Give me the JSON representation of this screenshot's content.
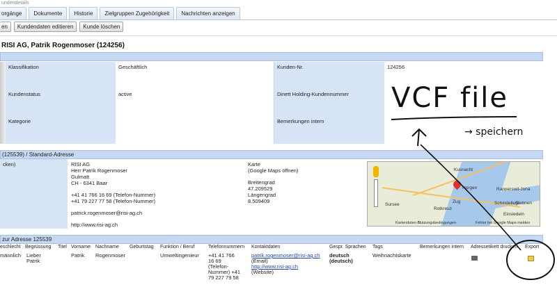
{
  "breadcrumb": "undendetails",
  "tabs": [
    "orgänge",
    "Dokumente",
    "Historie",
    "Zielgruppen Zugehörigkeit",
    "Nachrichten anzeigen"
  ],
  "actions": [
    "en",
    "Kundendaten editieren",
    "Kunde löschen"
  ],
  "customer_title": "RISI AG, Patrik Rogenmoser (124256)",
  "details": {
    "klassifikation_label": "Klassifikation",
    "klassifikation_value": "Geschäftlich",
    "kundennr_label": "Kunden-Nr.",
    "kundennr_value": "124256",
    "status_label": "Kundenstatus",
    "status_value": "active",
    "dinett_label": "Dinett Holding-Kundennummer",
    "kategorie_label": "Kategorie",
    "bemerkungen_label": "Bemerkungen intern"
  },
  "address": {
    "header": "(125539) / Standard-Adresse",
    "left_label": "cken)",
    "company": "RISI AG",
    "person": "Herr Patrik Rogenmoser",
    "street": "Gulmatt",
    "city": "CH - 6341 Baar",
    "phone1": "+41 41 766 16 69 (Telefon-Nummer)",
    "phone2": "+41 79 227 77 58 (Telefon-Nummer)",
    "email": "patrick.rogenmoser@risi-ag.ch",
    "website": "http://www.risi-ag.ch",
    "map_label": "Karte",
    "map_link": "(Google Maps öffnen)",
    "lat_label": "Breitengrad",
    "lat_value": "47.209529",
    "lon_label": "Längengrad",
    "lon_value": "8.509409"
  },
  "map_labels": [
    "Kusnacht",
    "Horgen",
    "Rapperswil-Jona",
    "Zug",
    "Sursee",
    "Rotkreuz",
    "Einsiedeln",
    "Schindellegi",
    "Siebnen",
    "Kartendaten ©",
    "Nutzungsbedingungen",
    "Fehler bei Google Maps melden"
  ],
  "contacts": {
    "header": "zur Adresse 125539",
    "columns": [
      "eschlecht",
      "Begrüssung",
      "Titel",
      "Vorname",
      "Nachname",
      "Geburtstag",
      "Funktion / Beruf",
      "Telefonnummern",
      "Kontaktdaten",
      "Gespr. Sprachen",
      "Tags",
      "Bemerkungen intern",
      "Adressetikett drucken",
      "Export"
    ],
    "row": {
      "geschlecht": "männlich",
      "begruessung": "Lieber Patrik",
      "vorname": "Patrik",
      "nachname": "Rogenmoser",
      "funktion": "Umweltingenieur",
      "telefon": "+41 41 766 16 69 (Telefon-Nummer) +41 79 227 79 58",
      "email": "patrik.rogenmoser@risi-ag.ch",
      "email_type": "(Email)",
      "website": "http://www.risi-ag.ch",
      "website_type": "(Website)",
      "sprachen": "deutsch (deutsch)",
      "tags": "Weihnachtskarte"
    }
  },
  "annotation": {
    "main": "VCF file",
    "arrow_text": "→ speichern"
  }
}
